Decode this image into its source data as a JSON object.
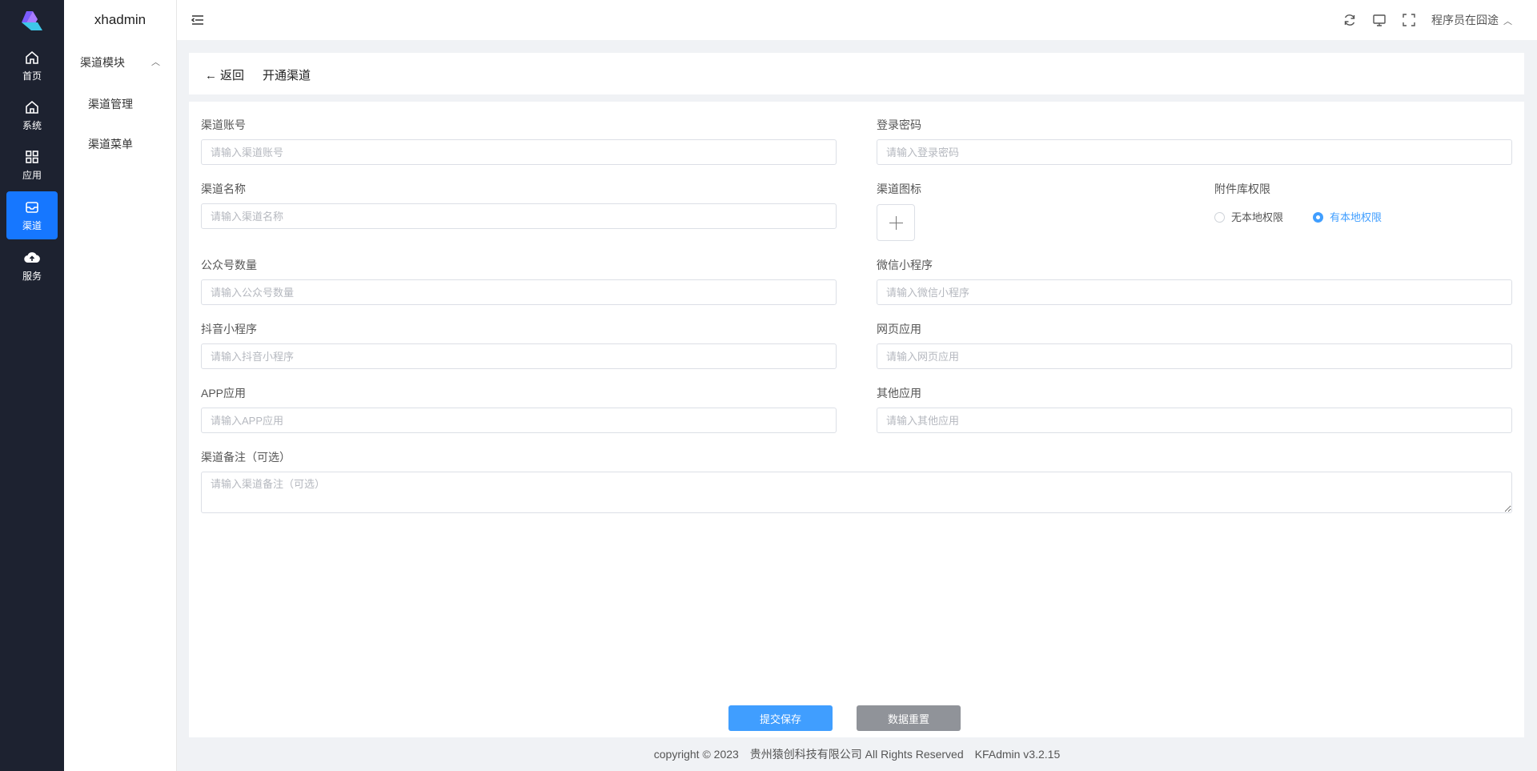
{
  "rail": {
    "items": [
      {
        "label": "首页",
        "icon": "home-icon"
      },
      {
        "label": "系统",
        "icon": "home-outline-icon"
      },
      {
        "label": "应用",
        "icon": "grid-icon"
      },
      {
        "label": "渠道",
        "icon": "inbox-icon"
      },
      {
        "label": "服务",
        "icon": "cloud-upload-icon"
      }
    ],
    "active_color": "#1677ff"
  },
  "menu": {
    "brand": "xhadmin",
    "group": "渠道模块",
    "items": [
      "渠道管理",
      "渠道菜单"
    ]
  },
  "topbar": {
    "user": "程序员在囧途"
  },
  "header": {
    "back": "返回",
    "title": "开通渠道"
  },
  "form": {
    "account": {
      "label": "渠道账号",
      "placeholder": "请输入渠道账号"
    },
    "password": {
      "label": "登录密码",
      "placeholder": "请输入登录密码"
    },
    "name": {
      "label": "渠道名称",
      "placeholder": "请输入渠道名称"
    },
    "icon": {
      "label": "渠道图标"
    },
    "permission": {
      "label": "附件库权限",
      "options": [
        "无本地权限",
        "有本地权限"
      ],
      "selected": "有本地权限"
    },
    "mp_count": {
      "label": "公众号数量",
      "placeholder": "请输入公众号数量"
    },
    "wechat_mini": {
      "label": "微信小程序",
      "placeholder": "请输入微信小程序"
    },
    "douyin_mini": {
      "label": "抖音小程序",
      "placeholder": "请输入抖音小程序"
    },
    "web_app": {
      "label": "网页应用",
      "placeholder": "请输入网页应用"
    },
    "app": {
      "label": "APP应用",
      "placeholder": "请输入APP应用"
    },
    "other": {
      "label": "其他应用",
      "placeholder": "请输入其他应用"
    },
    "remark": {
      "label": "渠道备注（可选）",
      "placeholder": "请输入渠道备注（可选）"
    },
    "submit": "提交保存",
    "reset": "数据重置"
  },
  "footer": "copyright © 2023　贵州猿创科技有限公司 All Rights Reserved　KFAdmin v3.2.15"
}
